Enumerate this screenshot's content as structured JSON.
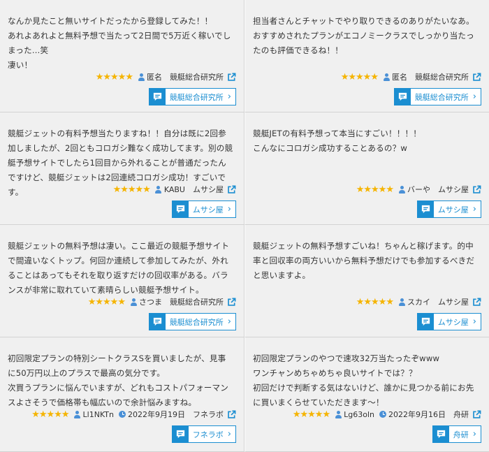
{
  "reviews": [
    {
      "text": "なんか見たこと無いサイトだったから登録してみた！！\nあれよあれよと無料予想で当たって2日間で5万近く稼いでしまった…笑\n凄い！",
      "rating": 5,
      "stars": "★★★★★",
      "user": "匿名",
      "date": "",
      "site": "競艇総合研究所",
      "button": "競艇総合研究所"
    },
    {
      "text": "担当者さんとチャットでやり取りできるのありがたいなあ。\nおすすめされたプランがエコノミークラスでしっかり当たったのも評価できるね！！",
      "rating": 5,
      "stars": "★★★★★",
      "user": "匿名",
      "date": "",
      "site": "競艇総合研究所",
      "button": "競艇総合研究所"
    },
    {
      "text": "競艇ジェットの有料予想当たりますね！！自分は既に2回参加しましたが、2回ともコロガシ難なく成功してます。別の競艇予想サイトでしたら1回目から外れることが普通だったんですけど、競艇ジェットは2回連続コロガシ成功！すごいです。",
      "rating": 5,
      "stars": "★★★★★",
      "user": "KABU",
      "date": "",
      "site": "ムサシ屋",
      "button": "ムサシ屋"
    },
    {
      "text": "競艇JETの有料予想って本当にすごい！！！！\nこんなにコロガシ成功することあるの？w",
      "rating": 5,
      "stars": "★★★★★",
      "user": "バーや",
      "date": "",
      "site": "ムサシ屋",
      "button": "ムサシ屋"
    },
    {
      "text": "競艇ジェットの無料予想は凄い。ここ最近の競艇予想サイトで間違いなくトップ。何回か連続して参加してみたが、外れることはあってもそれを取り返すだけの回収率がある。バランスが非常に取れていて素晴らしい競艇予想サイト。",
      "rating": 5,
      "stars": "★★★★★",
      "user": "さつま",
      "date": "",
      "site": "競艇総合研究所",
      "button": "競艇総合研究所"
    },
    {
      "text": "競艇ジェットの無料予想すごいね！ちゃんと稼げます。的中率と回収率の両方いいから無料予想だけでも参加するべきだと思いますよ。",
      "rating": 5,
      "stars": "★★★★★",
      "user": "スカイ",
      "date": "",
      "site": "ムサシ屋",
      "button": "ムサシ屋"
    },
    {
      "text": "初回限定プランの特別シートクラスSを買いましたが、見事に50万円以上のプラスで最高の気分です。\n次買うプランに悩んでいますが、どれもコストパフォーマンスよさそうで価格帯も幅広いので余計悩みますね。",
      "rating": 5,
      "stars": "★★★★★",
      "user": "Ll1NKTn",
      "date": "2022年9月19日",
      "site": "フネラボ",
      "button": "フネラボ"
    },
    {
      "text": "初回限定プランのやつで速攻32万当たったぞwww\nワンチャンめちゃめちゃ良いサイトでは？？\n初回だけで判断する気はないけど、誰かに見つかる前にお先に買いまくらせていただきます～！",
      "rating": 5,
      "stars": "★★★★★",
      "user": "Lg63oln",
      "date": "2022年9月16日",
      "site": "舟研",
      "button": "舟研"
    }
  ],
  "colors": {
    "accent": "#1b8ed1",
    "star": "#f5b400",
    "icon": "#4a90d6"
  },
  "icons": {
    "user": "user-icon",
    "date": "clock-icon",
    "external": "external-link-icon",
    "button": "chat-bubble-icon",
    "chevron": "chevron-right-icon"
  }
}
